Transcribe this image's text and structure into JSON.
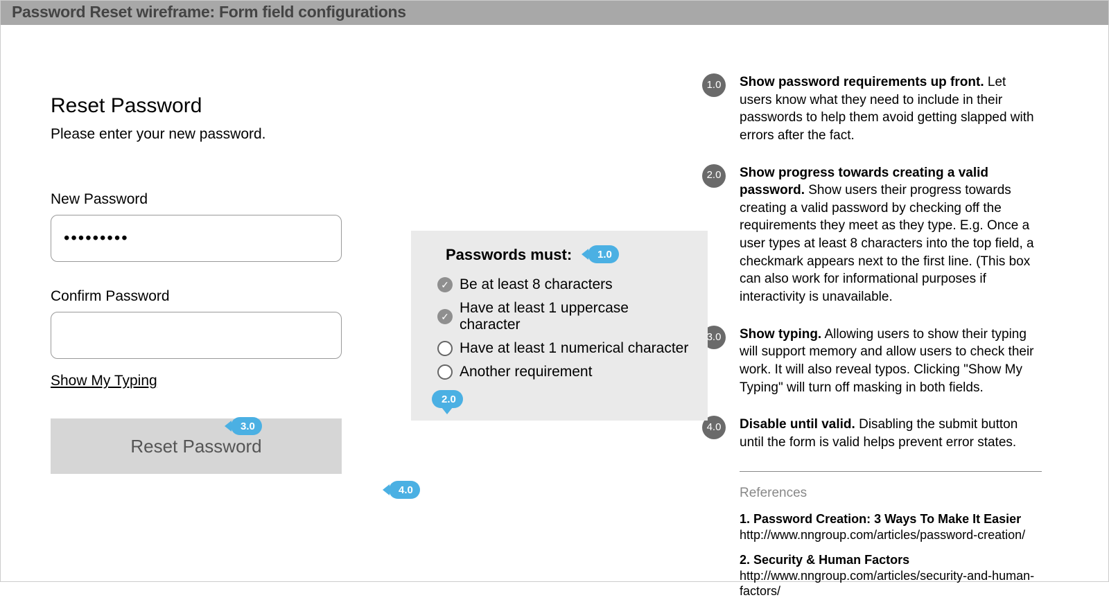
{
  "header": {
    "title": "Password Reset wireframe: Form field configurations"
  },
  "form": {
    "heading": "Reset Password",
    "subheading": "Please enter your new password.",
    "new_password_label": "New Password",
    "new_password_value": "•••••••••",
    "confirm_password_label": "Confirm Password",
    "confirm_password_value": "",
    "show_typing_label": "Show My Typing",
    "submit_label": "Reset Password"
  },
  "requirements": {
    "title": "Passwords must:",
    "items": [
      {
        "met": true,
        "text": "Be at least 8 characters"
      },
      {
        "met": true,
        "text": "Have at least 1 uppercase character"
      },
      {
        "met": false,
        "text": "Have at least 1 numerical character"
      },
      {
        "met": false,
        "text": "Another requirement"
      }
    ]
  },
  "balloons": {
    "b1": "1.0",
    "b2": "2.0",
    "b3": "3.0",
    "b4": "4.0"
  },
  "annotations": [
    {
      "num": "1.0",
      "bold": "Show password requirements up front.",
      "body": " Let users know what they need to include in their passwords to help them avoid getting slapped with errors after the fact."
    },
    {
      "num": "2.0",
      "bold": "Show progress towards creating a valid password.",
      "body": " Show users their progress towards creating a valid password by checking off the requirements they meet as they type. E.g. Once a user types at least 8 characters into the top field, a checkmark appears next to the first line. (This box can also work for informational purposes if interactivity is unavailable."
    },
    {
      "num": "3.0",
      "bold": "Show typing.",
      "body": " Allowing users to show their typing will support memory and allow users to check their work. It will also reveal typos. Clicking \"Show My Typing\" will turn off masking in both fields."
    },
    {
      "num": "4.0",
      "bold": "Disable until valid.",
      "body": " Disabling the submit button until the form is valid helps prevent error states."
    }
  ],
  "references": {
    "heading": "References",
    "items": [
      {
        "num": "1.",
        "title": "Password Creation: 3 Ways To Make It Easier",
        "url": "http://www.nngroup.com/articles/password-creation/"
      },
      {
        "num": "2.",
        "title": "Security & Human Factors",
        "url": "http://www.nngroup.com/articles/security-and-human-factors/"
      }
    ]
  }
}
